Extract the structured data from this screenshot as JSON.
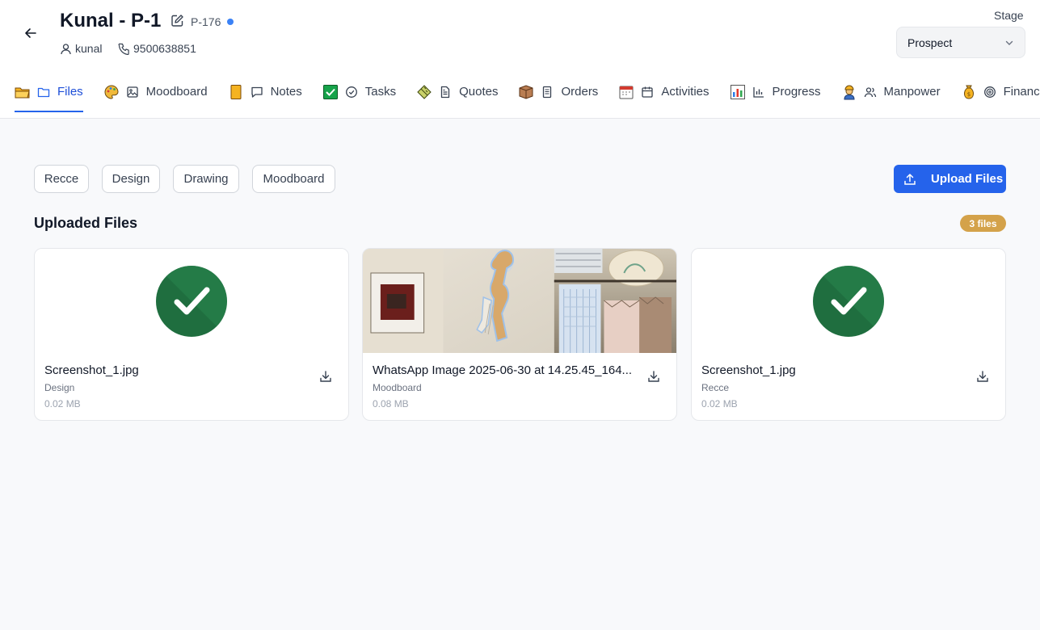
{
  "header": {
    "title": "Kunal - P-1",
    "project_code": "P-176",
    "user": "kunal",
    "phone": "9500638851",
    "stage_label": "Stage",
    "stage_value": "Prospect"
  },
  "tabs": [
    {
      "label": "Files",
      "emoji": "📂",
      "icon": "folder-icon",
      "active": true
    },
    {
      "label": "Moodboard",
      "emoji": "🎨",
      "icon": "image-icon"
    },
    {
      "label": "Notes",
      "emoji": "📒",
      "icon": "message-icon"
    },
    {
      "label": "Tasks",
      "emoji": "✅",
      "icon": "check-circle-icon"
    },
    {
      "label": "Quotes",
      "emoji": "📐",
      "icon": "document-icon"
    },
    {
      "label": "Orders",
      "emoji": "📦",
      "icon": "receipt-icon"
    },
    {
      "label": "Activities",
      "emoji": "📅",
      "icon": "calendar-icon"
    },
    {
      "label": "Progress",
      "emoji": "📊",
      "icon": "bar-chart-icon"
    },
    {
      "label": "Manpower",
      "emoji": "👷",
      "icon": "users-icon"
    },
    {
      "label": "Finances",
      "emoji": "💰",
      "icon": "target-icon"
    }
  ],
  "filters": [
    "Recce",
    "Design",
    "Drawing",
    "Moodboard"
  ],
  "upload_label": "Upload Files",
  "section_title": "Uploaded Files",
  "files_count": "3 files",
  "files": [
    {
      "name": "Screenshot_1.jpg",
      "category": "Design",
      "size": "0.02 MB",
      "thumb": "check"
    },
    {
      "name": "WhatsApp Image 2025-06-30 at 14.25.45_164...",
      "category": "Moodboard",
      "size": "0.08 MB",
      "thumb": "photo"
    },
    {
      "name": "Screenshot_1.jpg",
      "category": "Recce",
      "size": "0.02 MB",
      "thumb": "check"
    }
  ],
  "colors": {
    "accent": "#2563eb",
    "badge": "#d4a24a",
    "check": "#1f7a45"
  }
}
